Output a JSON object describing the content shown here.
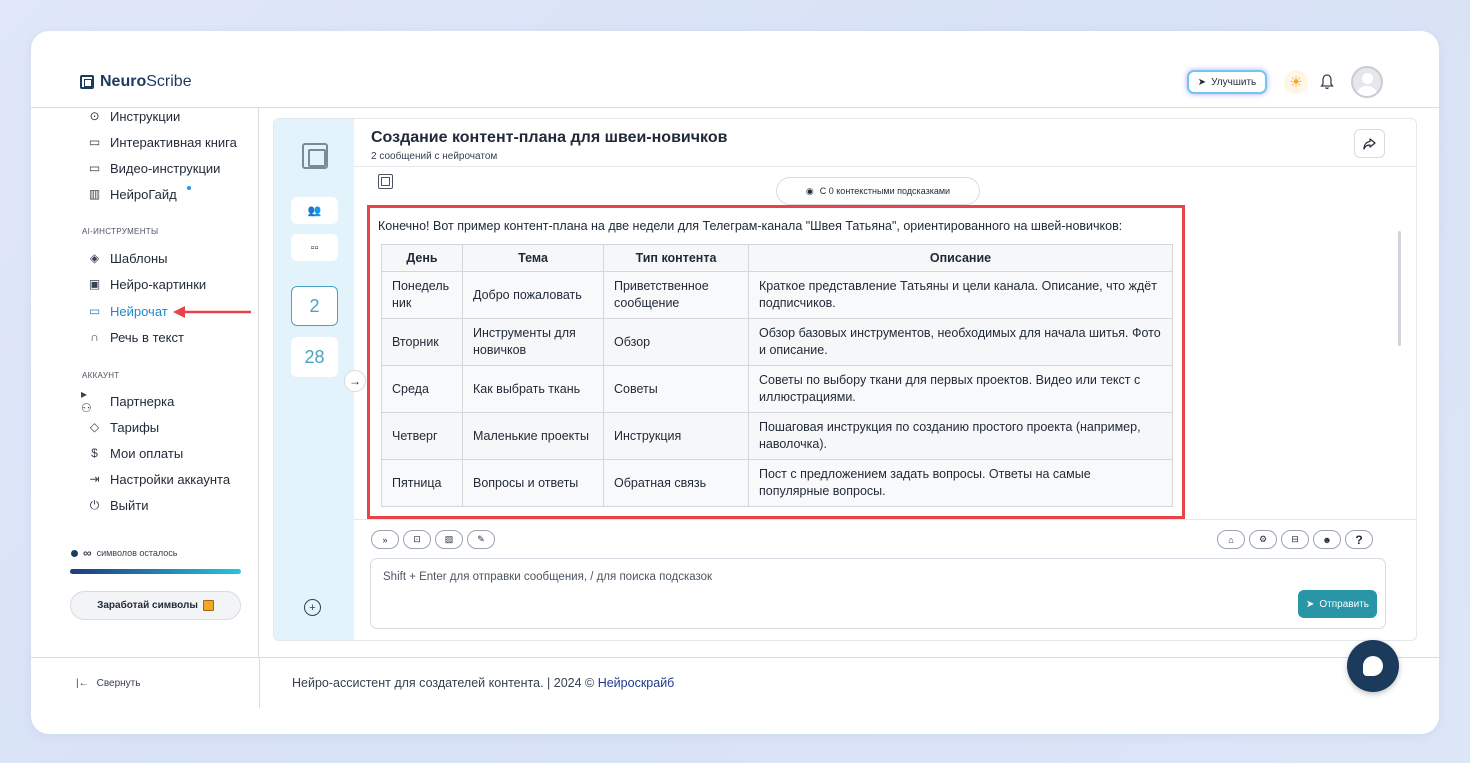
{
  "header": {
    "logo_bold": "Neuro",
    "logo_rest": "Scribe",
    "upgrade_label": "Улучшить"
  },
  "sidebar": {
    "items_top": [
      {
        "label": "Инструкции",
        "icon": "help-circle-icon"
      },
      {
        "label": "Интерактивная книга",
        "icon": "book-icon"
      },
      {
        "label": "Видео-инструкции",
        "icon": "video-icon"
      },
      {
        "label": "НейроГайд",
        "icon": "guide-icon"
      }
    ],
    "section_ai": "AI-ИНСТРУМЕНТЫ",
    "items_ai": [
      {
        "label": "Шаблоны",
        "icon": "layers-icon"
      },
      {
        "label": "Нейро-картинки",
        "icon": "image-icon"
      },
      {
        "label": "Нейрочат",
        "icon": "chat-icon"
      },
      {
        "label": "Речь в текст",
        "icon": "headphones-icon"
      }
    ],
    "section_account": "АККАУНТ",
    "items_account": [
      {
        "label": "Партнерка",
        "icon": "users-icon"
      },
      {
        "label": "Тарифы",
        "icon": "tag-icon"
      },
      {
        "label": "Мои оплаты",
        "icon": "dollar-icon"
      },
      {
        "label": "Настройки аккаунта",
        "icon": "login-icon"
      },
      {
        "label": "Выйти",
        "icon": "power-icon"
      }
    ],
    "symbols_infinity": "∞",
    "symbols_label": "символов осталось",
    "earn_label": "Заработай символы",
    "collapse_label": "Свернуть"
  },
  "chat_side": {
    "counts": [
      "2",
      "28"
    ]
  },
  "chat": {
    "title": "Создание контент-плана для швеи-новичков",
    "subtitle": "2 сообщений с нейрочатом",
    "context_pill": "С 0 контекстными подсказками",
    "message_intro": "Конечно! Вот пример контент-плана на две недели для Телеграм-канала \"Швея Татьяна\", ориентированного на швей-новичков:",
    "table": {
      "headers": [
        "День",
        "Тема",
        "Тип контента",
        "Описание"
      ],
      "rows": [
        [
          "Понедельник",
          "Добро пожаловать",
          "Приветственное сообщение",
          "Краткое представление Татьяны и цели канала. Описание, что ждёт подписчиков."
        ],
        [
          "Вторник",
          "Инструменты для новичков",
          "Обзор",
          "Обзор базовых инструментов, необходимых для начала шитья. Фото и описание."
        ],
        [
          "Среда",
          "Как выбрать ткань",
          "Советы",
          "Советы по выбору ткани для первых проектов. Видео или текст с иллюстрациями."
        ],
        [
          "Четверг",
          "Маленькие проекты",
          "Инструкция",
          "Пошаговая инструкция по созданию простого проекта (например, наволочка)."
        ],
        [
          "Пятница",
          "Вопросы и ответы",
          "Обратная связь",
          "Пост с предложением задать вопросы. Ответы на самые популярные вопросы."
        ]
      ]
    },
    "input_placeholder": "Shift + Enter для отправки сообщения, / для поиска подсказок",
    "send_label": "Отправить"
  },
  "footer": {
    "text": "Нейро-ассистент для создателей контента.  | 2024 © ",
    "link": "Нейроскрайб"
  },
  "colors": {
    "accent": "#2996a8",
    "annotation_red": "#e8434a",
    "chat_side_bg": "#e3f3fb"
  }
}
